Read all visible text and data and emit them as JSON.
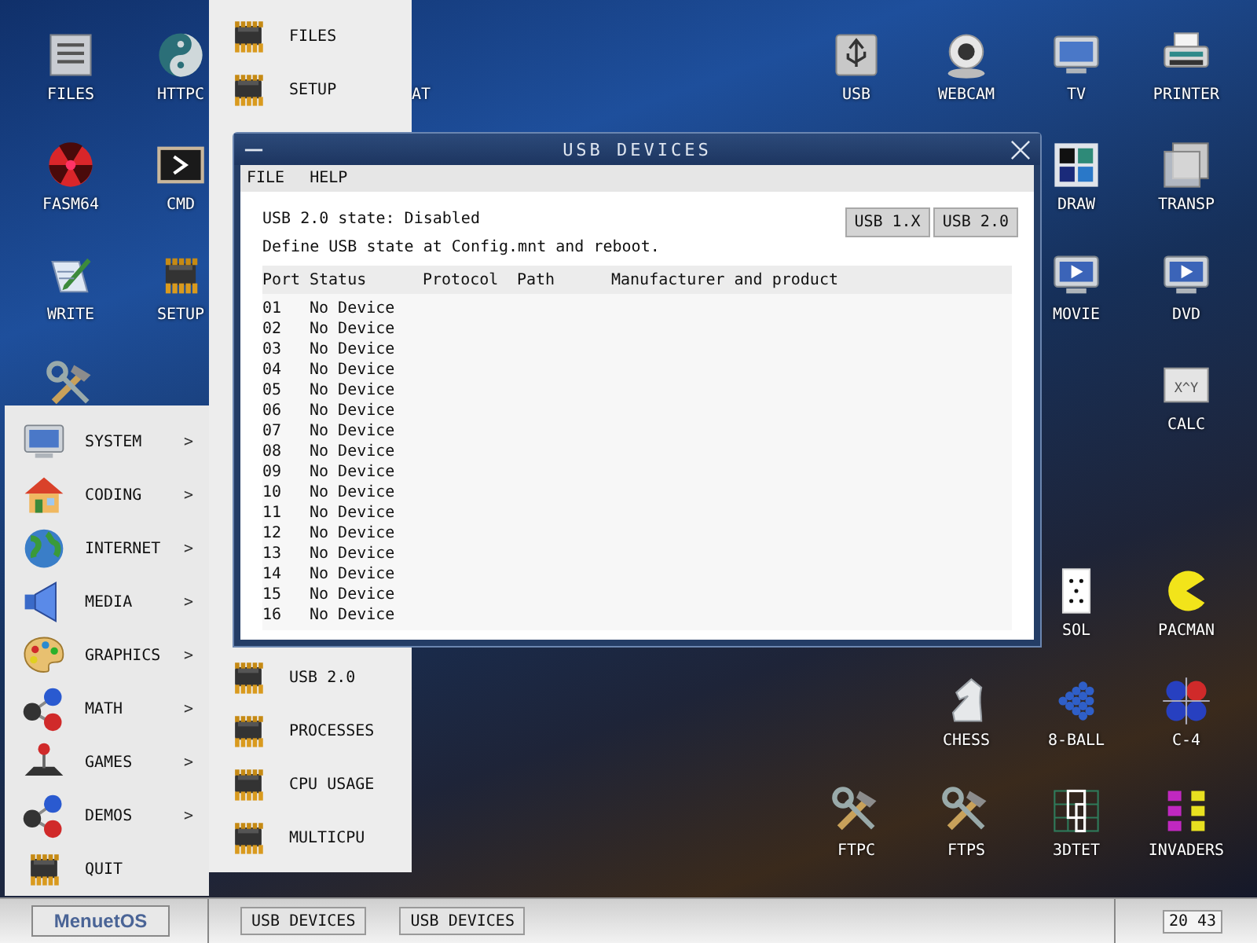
{
  "desktop_icons": [
    {
      "label": "FILES",
      "kind": "files"
    },
    {
      "label": "HTTPC",
      "kind": "yinyang"
    },
    {
      "label": "AT",
      "kind": "none"
    },
    {
      "label": "USB",
      "kind": "usb"
    },
    {
      "label": "WEBCAM",
      "kind": "webcam"
    },
    {
      "label": "TV",
      "kind": "monitor"
    },
    {
      "label": "PRINTER",
      "kind": "printer"
    },
    {
      "label": "FASM64",
      "kind": "fasm"
    },
    {
      "label": "CMD",
      "kind": "cmd"
    },
    {
      "label": "DRAW",
      "kind": "draw"
    },
    {
      "label": "TRANSP",
      "kind": "transp"
    },
    {
      "label": "WRITE",
      "kind": "write"
    },
    {
      "label": "SETUP",
      "kind": "chip"
    },
    {
      "label": "MOVIE",
      "kind": "play"
    },
    {
      "label": "DVD",
      "kind": "play"
    },
    {
      "kind": "tools"
    },
    {
      "label": "CALC",
      "kind": "calc",
      "badge": "X^Y"
    },
    {
      "label": "SOL",
      "kind": "card"
    },
    {
      "label": "PACMAN",
      "kind": "pacman"
    },
    {
      "label": "CHESS",
      "kind": "knight"
    },
    {
      "label": "8-BALL",
      "kind": "balls"
    },
    {
      "label": "C-4",
      "kind": "c4"
    },
    {
      "label": "FTPC",
      "kind": "tools"
    },
    {
      "label": "FTPS",
      "kind": "tools"
    },
    {
      "label": "3DTET",
      "kind": "grid"
    },
    {
      "label": "INVADERS",
      "kind": "invaders"
    }
  ],
  "submenu": {
    "top_items": [
      {
        "label": "FILES",
        "kind": "chip"
      },
      {
        "label": "SETUP",
        "kind": "chip"
      }
    ],
    "bottom_items": [
      {
        "label": "USB 2.0",
        "kind": "chip"
      },
      {
        "label": "PROCESSES",
        "kind": "chip"
      },
      {
        "label": "CPU USAGE",
        "kind": "chip"
      },
      {
        "label": "MULTICPU",
        "kind": "chip"
      }
    ]
  },
  "main_menu": [
    {
      "label": "SYSTEM",
      "kind": "monitor",
      "arrow": ">"
    },
    {
      "label": "CODING",
      "kind": "house",
      "arrow": ">"
    },
    {
      "label": "INTERNET",
      "kind": "globe",
      "arrow": ">"
    },
    {
      "label": "MEDIA",
      "kind": "speaker",
      "arrow": ">"
    },
    {
      "label": "GRAPHICS",
      "kind": "palette",
      "arrow": ">"
    },
    {
      "label": "MATH",
      "kind": "molecule",
      "arrow": ">"
    },
    {
      "label": "GAMES",
      "kind": "joystick",
      "arrow": ">"
    },
    {
      "label": "DEMOS",
      "kind": "molecule",
      "arrow": ">"
    },
    {
      "label": "QUIT",
      "kind": "chip"
    }
  ],
  "window": {
    "title": "USB DEVICES",
    "menu": [
      "FILE",
      "HELP"
    ],
    "state_text": "USB 2.0 state: Disabled",
    "hint": "Define USB state at Config.mnt and reboot.",
    "buttons": [
      "USB 1.X",
      "USB 2.0"
    ],
    "table": {
      "columns": [
        "Port",
        "Status",
        "Protocol",
        "Path",
        "Manufacturer and product"
      ],
      "rows": [
        [
          "01",
          "No Device"
        ],
        [
          "02",
          "No Device"
        ],
        [
          "03",
          "No Device"
        ],
        [
          "04",
          "No Device"
        ],
        [
          "05",
          "No Device"
        ],
        [
          "06",
          "No Device"
        ],
        [
          "07",
          "No Device"
        ],
        [
          "08",
          "No Device"
        ],
        [
          "09",
          "No Device"
        ],
        [
          "10",
          "No Device"
        ],
        [
          "11",
          "No Device"
        ],
        [
          "12",
          "No Device"
        ],
        [
          "13",
          "No Device"
        ],
        [
          "14",
          "No Device"
        ],
        [
          "15",
          "No Device"
        ],
        [
          "16",
          "No Device"
        ]
      ]
    }
  },
  "taskbar": {
    "start": "MenuetOS",
    "tasks": [
      "USB DEVICES",
      "USB DEVICES"
    ],
    "clock": "20 43"
  }
}
